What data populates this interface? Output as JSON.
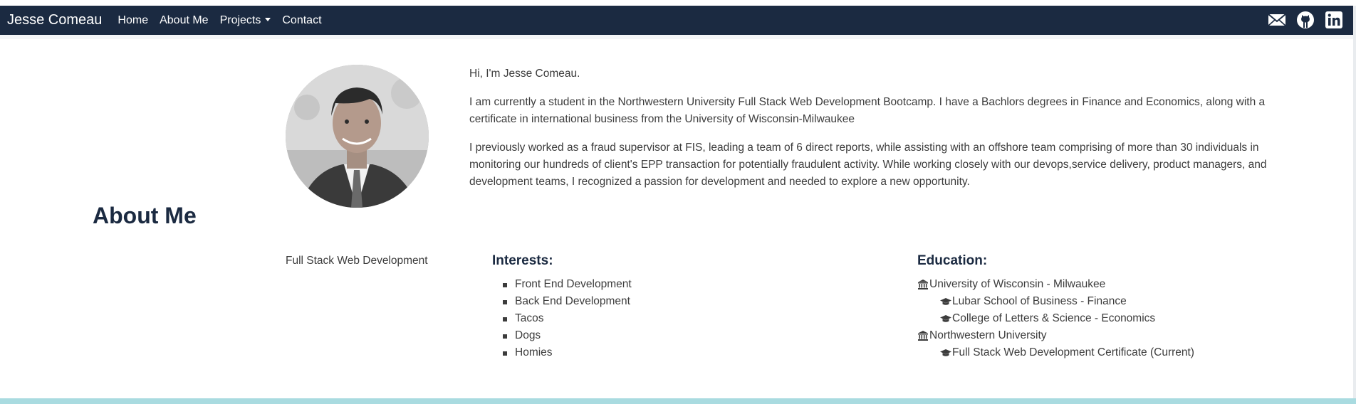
{
  "navbar": {
    "brand": "Jesse Comeau",
    "links": [
      "Home",
      "About Me",
      "Projects",
      "Contact"
    ],
    "icons": [
      "email-icon",
      "github-icon",
      "linkedin-icon"
    ]
  },
  "bio": {
    "greeting": "Hi, I'm Jesse Comeau.",
    "paragraph1": "I am currently a student in the Northwestern University Full Stack Web Development Bootcamp. I have a Bachlors degrees in Finance and Economics, along with a certificate in international business from the University of Wisconsin-Milwaukee",
    "paragraph2": "I previously worked as a fraud supervisor at FIS, leading a team of 6 direct reports, while assisting with an offshore team comprising of more than 30 individuals in monitoring our hundreds of client's EPP transaction for potentially fraudulent activity. While working closely with our devops,service delivery, product managers, and development teams, I recognized a passion for development and needed to explore a new opportunity."
  },
  "about": {
    "title": "About Me",
    "subtitle": "Full Stack Web Development"
  },
  "interests": {
    "title": "Interests:",
    "items": [
      "Front End Development",
      "Back End Development",
      "Tacos",
      "Dogs",
      "Homies"
    ]
  },
  "education": {
    "title": "Education:",
    "rows": [
      {
        "text": "University of Wisconsin - Milwaukee",
        "icon": "university-icon",
        "level": 0
      },
      {
        "text": "Lubar School of Business - Finance",
        "icon": "graduation-cap-icon",
        "level": 1
      },
      {
        "text": "College of Letters & Science - Economics",
        "icon": "graduation-cap-icon",
        "level": 1
      },
      {
        "text": "Northwestern University",
        "icon": "university-icon",
        "level": 0
      },
      {
        "text": "Full Stack Web Development Certificate (Current)",
        "icon": "graduation-cap-icon",
        "level": 1
      }
    ]
  },
  "colors": {
    "navbar": "#1b2a41",
    "footer": "#a9dbe0",
    "heading": "#1b2a41"
  }
}
